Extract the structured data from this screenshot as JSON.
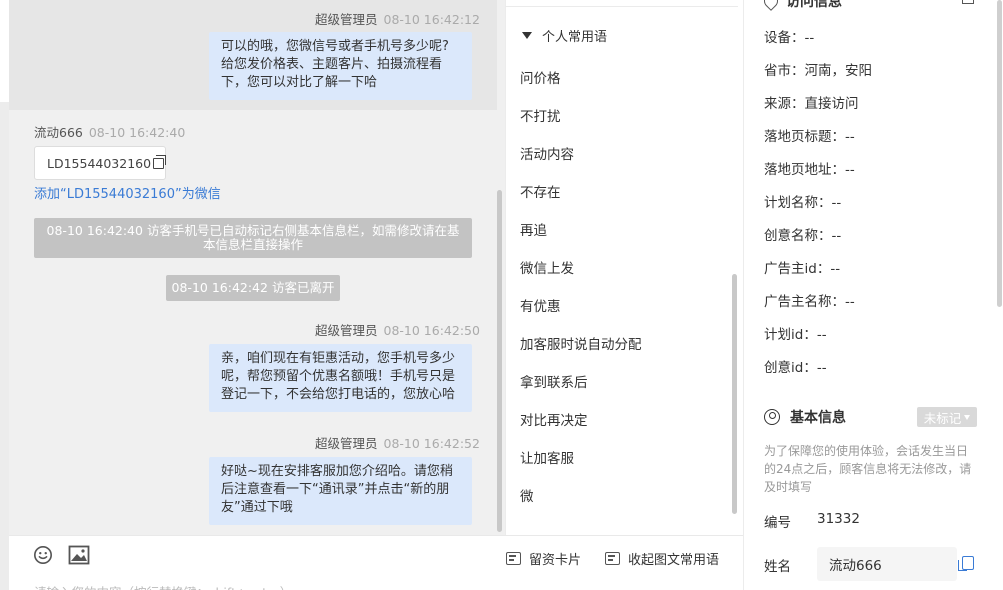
{
  "chat": {
    "messages": [
      {
        "sender": "超级管理员",
        "time": "08-10 16:42:12",
        "lines": [
          "可以的哦，您微信号或者手机号多少呢?",
          "给您发价格表、主题客片、拍摄流程看",
          "下，您可以对比了解一下哈"
        ]
      },
      {
        "sender": "流动666",
        "time": "08-10 16:42:40",
        "card_text": "LD15544032160",
        "add_wechat_link": "添加“LD15544032160”为微信"
      },
      {
        "system_text_1": "08-10 16:42:40 访客手机号已自动标记右侧基本信息栏，如需修改请在基",
        "system_text_2": "本信息栏直接操作"
      },
      {
        "system_text": "08-10 16:42:42 访客已离开"
      },
      {
        "sender": "超级管理员",
        "time": "08-10 16:42:50",
        "lines": [
          "亲，咱们现在有钜惠活动，您手机号多少",
          "呢，帮您预留个优惠名额哦！手机号只是",
          "登记一下，不会给您打电话的，您放心哈"
        ]
      },
      {
        "sender": "超级管理员",
        "time": "08-10 16:42:52",
        "lines": [
          "好哒~现在安排客服加您介绍哈。请您稍",
          "后注意查看一下“通讯录”并点击“新的朋",
          "友”通过下哦"
        ]
      }
    ],
    "input_hint": "请输入您的内容（按行替换键：shift+enter）"
  },
  "phrases": {
    "group_title": "个人常用语",
    "items": [
      "问价格",
      "不打扰",
      "活动内容",
      "不存在",
      "再追",
      "微信上发",
      "有优惠",
      "加客服时说自动分配",
      "拿到联系后",
      "对比再决定",
      "让加客服",
      "微"
    ],
    "leave_card": "留资卡片",
    "collapse": "收起图文常用语"
  },
  "info": {
    "top_title": "访问信息",
    "rows": [
      {
        "label": "设备：",
        "value": "--"
      },
      {
        "label": "省市：",
        "value": "河南，安阳"
      },
      {
        "label": "来源：",
        "value": "直接访问"
      },
      {
        "label": "落地页标题：",
        "value": "--"
      },
      {
        "label": "落地页地址：",
        "value": "--"
      },
      {
        "label": "计划名称：",
        "value": "--"
      },
      {
        "label": "创意名称：",
        "value": "--"
      },
      {
        "label": "广告主id：",
        "value": "--"
      },
      {
        "label": "广告主名称：",
        "value": "--"
      },
      {
        "label": "计划id：",
        "value": "--"
      },
      {
        "label": "创意id：",
        "value": "--"
      }
    ],
    "basic": {
      "title": "基本信息",
      "tag": "未标记",
      "notice": "为了保障您的使用体验，会话发生当日的24点之后，顾客信息将无法修改，请及时填写",
      "id_label": "编号",
      "id_value": "31332",
      "name_label": "姓名",
      "name_value": "流动666"
    }
  },
  "colors": {
    "bubble": "#dbe8fb",
    "link": "#3a7bd5",
    "system": "#c3c3c3"
  }
}
